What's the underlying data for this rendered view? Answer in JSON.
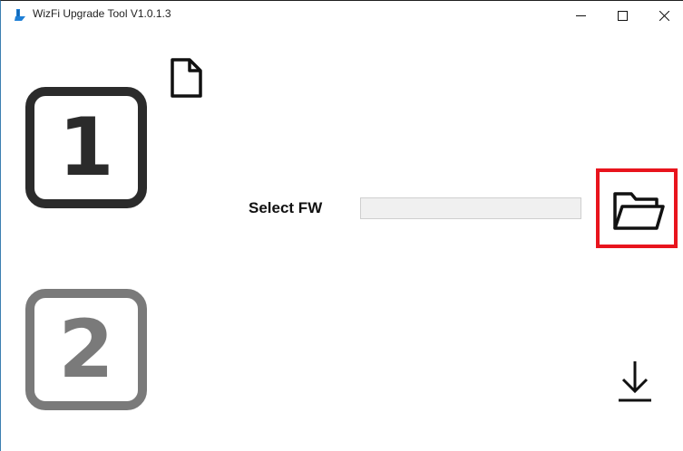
{
  "window": {
    "title": "WizFi Upgrade Tool V1.0.1.3",
    "icon": "wizfi-app-icon"
  },
  "window_controls": {
    "minimize_icon": "minimize-icon",
    "maximize_icon": "maximize-icon",
    "close_icon": "close-icon"
  },
  "steps": [
    {
      "number": "1",
      "state": "active",
      "color": "#2b2b2b"
    },
    {
      "number": "2",
      "state": "inactive",
      "color": "#7a7a7a"
    }
  ],
  "step1": {
    "file_icon": "file-icon",
    "select_label": "Select FW",
    "fw_path_value": "",
    "browse_icon": "folder-open-icon",
    "highlight_color": "#e8141d"
  },
  "step2": {
    "download_icon": "download-arrow-icon"
  },
  "colors": {
    "app_icon": "#1e7fd6",
    "input_background": "#f0f0f0"
  }
}
